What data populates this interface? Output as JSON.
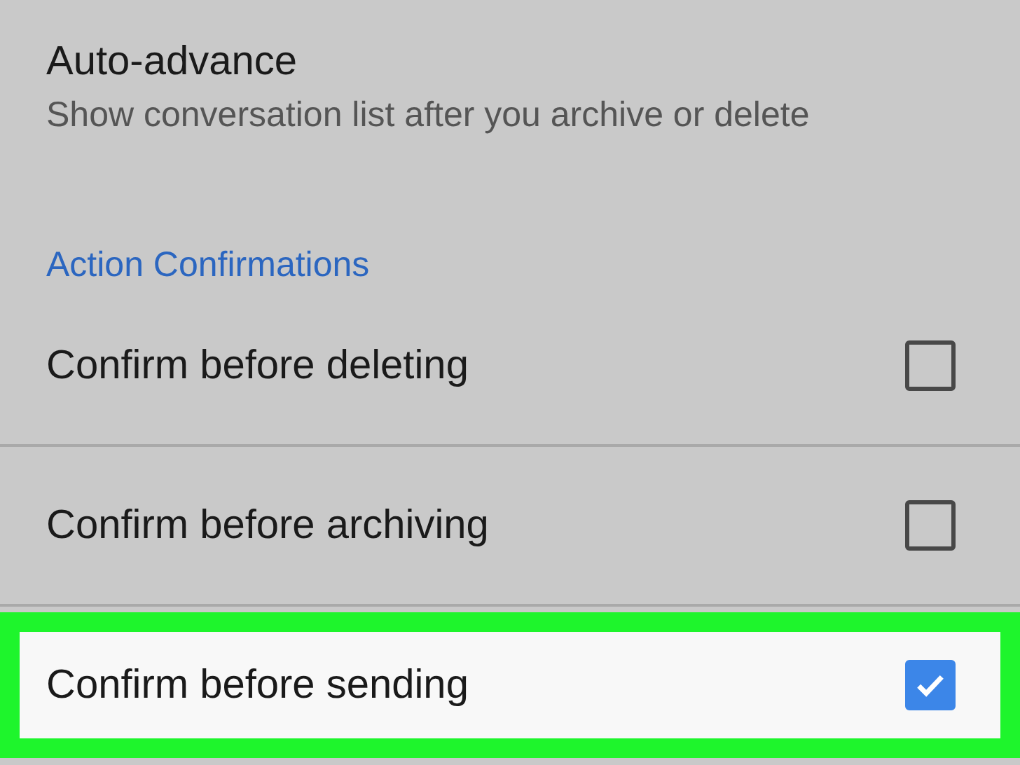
{
  "auto_advance": {
    "title": "Auto-advance",
    "description": "Show conversation list after you archive or delete"
  },
  "section": {
    "title": "Action Confirmations"
  },
  "rows": [
    {
      "label": "Confirm before deleting",
      "checked": false,
      "highlighted": false
    },
    {
      "label": "Confirm before archiving",
      "checked": false,
      "highlighted": false
    },
    {
      "label": "Confirm before sending",
      "checked": true,
      "highlighted": true
    }
  ]
}
